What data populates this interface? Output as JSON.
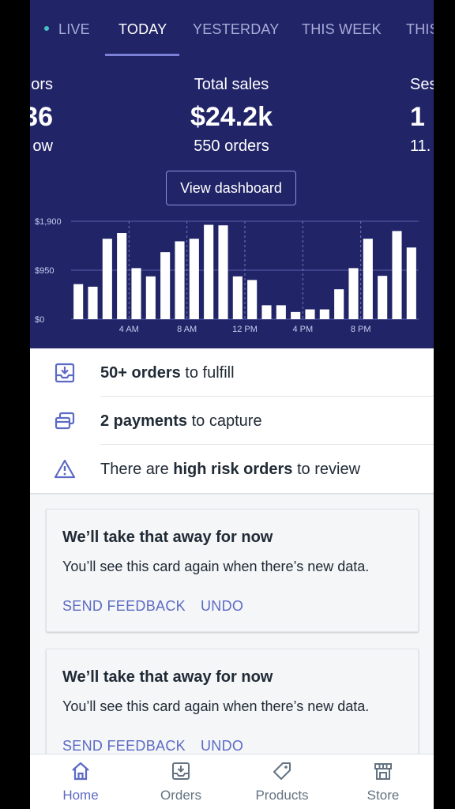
{
  "tabs": [
    {
      "label": "LIVE",
      "active": false
    },
    {
      "label": "TODAY",
      "active": true
    },
    {
      "label": "YESTERDAY",
      "active": false
    },
    {
      "label": "THIS WEEK",
      "active": false
    },
    {
      "label": "THIS",
      "active": false
    }
  ],
  "metrics": {
    "left": {
      "label": "ors",
      "value": "36",
      "sub": "ow"
    },
    "center": {
      "label": "Total sales",
      "value": "$24.2k",
      "sub": "550 orders"
    },
    "right": {
      "label": "Ses",
      "value": "1",
      "sub": "11."
    }
  },
  "view_dashboard_label": "View dashboard",
  "chart_data": {
    "type": "bar",
    "y_tick_labels": [
      "$1,900",
      "$950",
      "$0"
    ],
    "y_ticks": [
      1900,
      950,
      0
    ],
    "x_tick_labels": [
      "4 AM",
      "8 AM",
      "12 PM",
      "4 PM",
      "8 PM"
    ],
    "x_tick_hours": [
      4,
      8,
      12,
      16,
      20
    ],
    "ylim": [
      0,
      1900
    ],
    "x": [
      0,
      1,
      2,
      3,
      4,
      5,
      6,
      7,
      8,
      9,
      10,
      11,
      12,
      13,
      14,
      15,
      16,
      17,
      18,
      19,
      20,
      21,
      22,
      23
    ],
    "values": [
      680,
      630,
      1560,
      1670,
      990,
      830,
      1300,
      1510,
      1560,
      1830,
      1820,
      830,
      760,
      270,
      270,
      140,
      190,
      190,
      580,
      990,
      1560,
      840,
      1710,
      1390
    ],
    "bar_color": "#ffffff",
    "grid": true
  },
  "tasks": [
    {
      "bold": "50+ orders",
      "rest": " to fulfill",
      "icon": "inbox-download-icon"
    },
    {
      "bold": "2 payments",
      "rest": " to capture",
      "icon": "payment-cards-icon"
    },
    {
      "pre": "There are ",
      "bold": "high risk orders",
      "rest": " to review",
      "icon": "warning-triangle-icon"
    }
  ],
  "cards": [
    {
      "title": "We’ll take that away for now",
      "body": "You’ll see this card again when there’s new data.",
      "feedback": "SEND FEEDBACK",
      "undo": "UNDO"
    },
    {
      "title": "We’ll take that away for now",
      "body": "You’ll see this card again when there’s new data.",
      "feedback": "SEND FEEDBACK",
      "undo": "UNDO"
    }
  ],
  "bottom_nav": [
    {
      "label": "Home",
      "icon": "home-icon",
      "active": true
    },
    {
      "label": "Orders",
      "icon": "orders-icon",
      "active": false
    },
    {
      "label": "Products",
      "icon": "tag-icon",
      "active": false
    },
    {
      "label": "Store",
      "icon": "store-icon",
      "active": false
    }
  ],
  "colors": {
    "header_bg": "#212467",
    "accent": "#5c6ac4",
    "tab_inactive": "#a9acd8",
    "live_dot": "#47c1bf"
  }
}
